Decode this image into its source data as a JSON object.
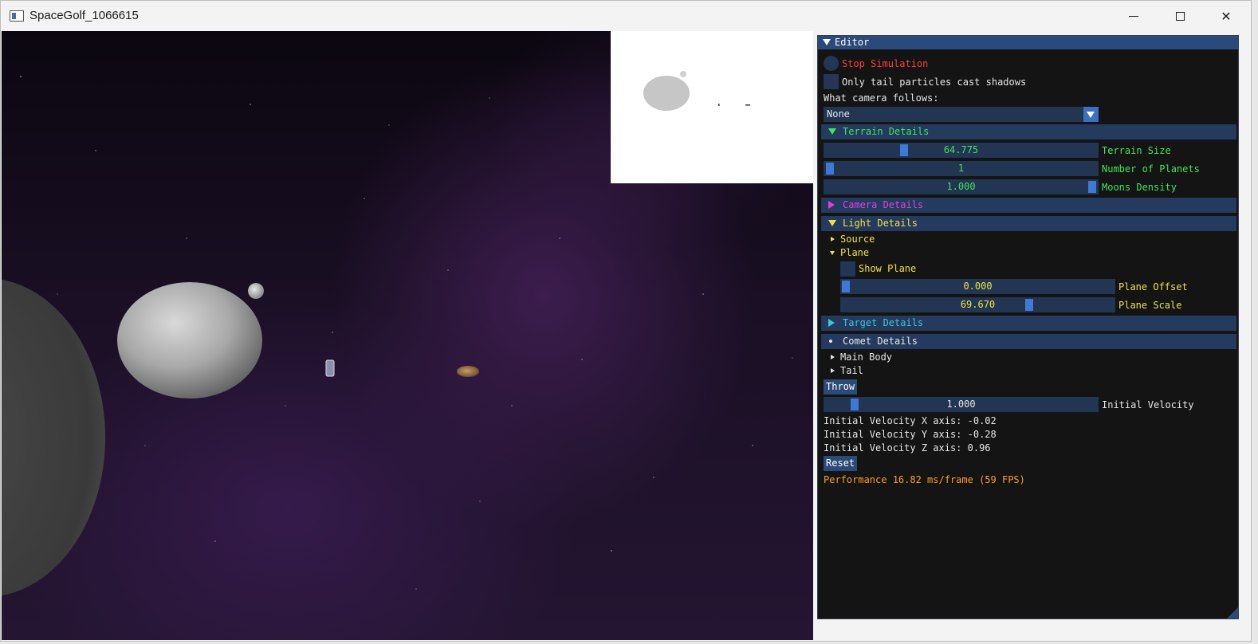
{
  "window": {
    "title": "SpaceGolf_1066615"
  },
  "editor": {
    "title": "Editor",
    "stop_simulation": "Stop Simulation",
    "only_tail_shadows": "Only tail particles cast shadows",
    "camera_follows_label": "What camera follows:",
    "camera_follows_value": "None",
    "sections": {
      "terrain": "Terrain Details",
      "camera": "Camera Details",
      "light": "Light Details",
      "target": "Target Details",
      "comet": "Comet Details"
    },
    "terrain": {
      "size": {
        "value": "64.775",
        "label": "Terrain Size",
        "fraction": 0.3
      },
      "planets": {
        "value": "1",
        "label": "Number of Planets",
        "fraction": 0.0
      },
      "moons": {
        "value": "1.000",
        "label": "Moons Density",
        "fraction": 1.0
      }
    },
    "light": {
      "source": "Source",
      "plane": "Plane",
      "show_plane": "Show Plane",
      "plane_offset": {
        "value": "0.000",
        "label": "Plane Offset",
        "fraction": 0.0
      },
      "plane_scale": {
        "value": "69.670",
        "label": "Plane Scale",
        "fraction": 0.7
      }
    },
    "comet": {
      "main_body": "Main Body",
      "tail": "Tail",
      "throw": "Throw",
      "initial_velocity": {
        "value": "1.000",
        "label": "Initial Velocity",
        "fraction": 0.1
      },
      "vel_x": "Initial Velocity X axis: -0.02",
      "vel_y": "Initial Velocity Y axis: -0.28",
      "vel_z": "Initial Velocity Z axis: 0.96",
      "reset": "Reset"
    },
    "performance": "Performance 16.82 ms/frame (59 FPS)"
  },
  "colors": {
    "stop_simulation": "#ff3b3b",
    "terrain": "#3ce65a",
    "camera": "#e040e0",
    "light": "#f0e040",
    "target": "#3ec6d8",
    "comet": "#e6e6e6",
    "performance": "#ff9f1a"
  }
}
